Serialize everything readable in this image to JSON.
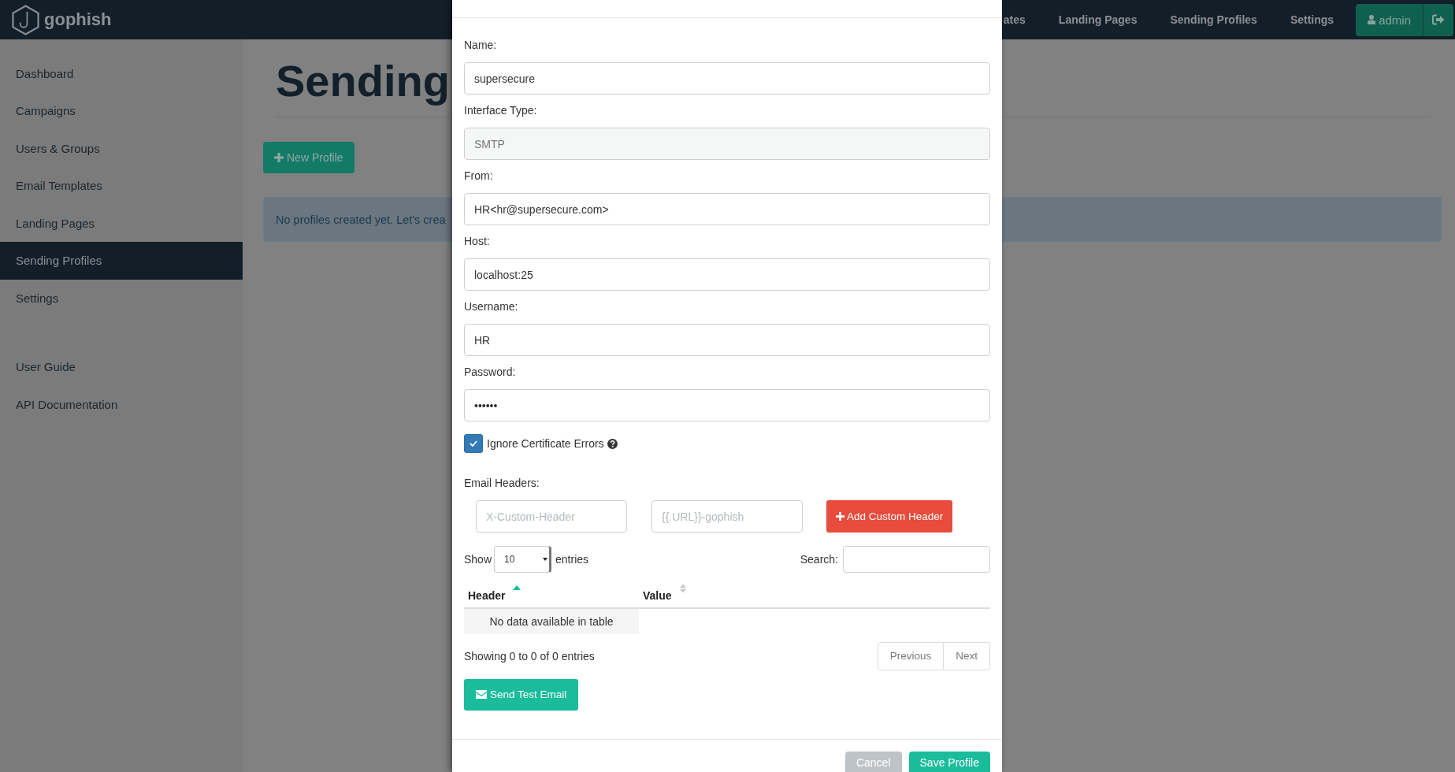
{
  "navbar": {
    "brand": "gophish",
    "links": [
      "ates",
      "Landing Pages",
      "Sending Profiles",
      "Settings"
    ],
    "user": "admin"
  },
  "sidebar": {
    "items": [
      {
        "label": "Dashboard",
        "selected": false
      },
      {
        "label": "Campaigns",
        "selected": false
      },
      {
        "label": "Users & Groups",
        "selected": false
      },
      {
        "label": "Email Templates",
        "selected": false
      },
      {
        "label": "Landing Pages",
        "selected": false
      },
      {
        "label": "Sending Profiles",
        "selected": true
      },
      {
        "label": "Settings",
        "selected": false
      }
    ],
    "bottom_items": [
      {
        "label": "User Guide",
        "selected": false
      },
      {
        "label": "API Documentation",
        "selected": false
      }
    ]
  },
  "page": {
    "title": "Sending",
    "new_button": "New Profile",
    "alert": "No profiles created yet. Let's crea"
  },
  "modal": {
    "fields": [
      {
        "label": "Name:",
        "value": "supersecure",
        "disabled": false
      },
      {
        "label": "Interface Type:",
        "value": "SMTP",
        "disabled": true
      },
      {
        "label": "From:",
        "value": "HR<hr@supersecure.com>",
        "disabled": false
      },
      {
        "label": "Host:",
        "value": "localhost:25",
        "disabled": false
      },
      {
        "label": "Username:",
        "value": "HR",
        "disabled": false
      },
      {
        "label": "Password:",
        "value": "••••••",
        "disabled": false
      }
    ],
    "ignore_cert": {
      "label": "Ignore Certificate Errors",
      "checked": true
    },
    "headers": {
      "label": "Email Headers:",
      "header_placeholder": "X-Custom-Header",
      "value_placeholder": "{{.URL}}-gophish",
      "add_button": "Add Custom Header"
    },
    "table": {
      "show_label": "Show",
      "page_size": "10",
      "entries_label": "entries",
      "search_label": "Search:",
      "columns": [
        {
          "label": "Header",
          "sorted": true
        },
        {
          "label": "Value",
          "sorted": false
        }
      ],
      "empty_text": "No data available in table",
      "info": "Showing 0 to 0 of 0 entries",
      "pagination": [
        {
          "label": "Previous",
          "disabled": true
        },
        {
          "label": "Next",
          "disabled": true
        }
      ]
    },
    "test_button": "Send Test Email",
    "footer_buttons": [
      {
        "label": "Cancel",
        "kind": "secondary"
      },
      {
        "label": "Save Profile",
        "kind": "primary"
      }
    ]
  }
}
